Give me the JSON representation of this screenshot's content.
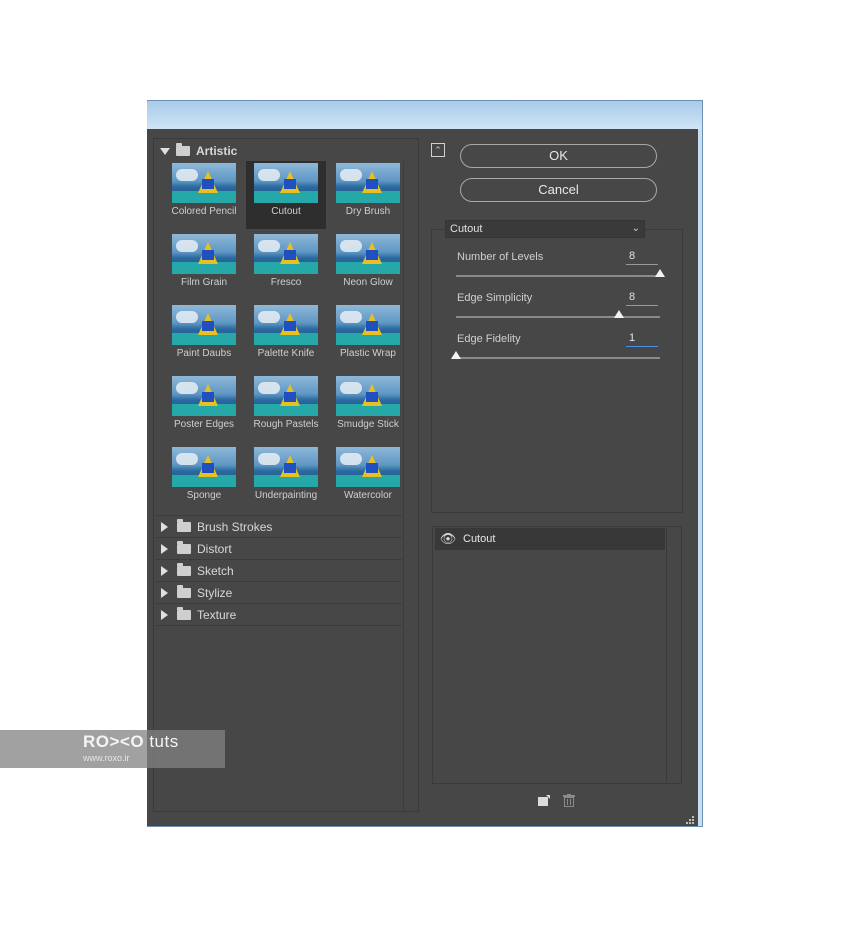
{
  "filter_gallery": {
    "categories": {
      "artistic": {
        "label": "Artistic",
        "filters": [
          {
            "label": "Colored Pencil"
          },
          {
            "label": "Cutout",
            "selected": true
          },
          {
            "label": "Dry Brush"
          },
          {
            "label": "Film Grain"
          },
          {
            "label": "Fresco"
          },
          {
            "label": "Neon Glow"
          },
          {
            "label": "Paint Daubs"
          },
          {
            "label": "Palette Knife"
          },
          {
            "label": "Plastic Wrap"
          },
          {
            "label": "Poster Edges"
          },
          {
            "label": "Rough Pastels"
          },
          {
            "label": "Smudge Stick"
          },
          {
            "label": "Sponge"
          },
          {
            "label": "Underpainting"
          },
          {
            "label": "Watercolor"
          }
        ]
      },
      "collapsed": [
        "Brush Strokes",
        "Distort",
        "Sketch",
        "Stylize",
        "Texture"
      ]
    }
  },
  "buttons": {
    "ok": "OK",
    "cancel": "Cancel"
  },
  "settings": {
    "filter_select": "Cutout",
    "params": [
      {
        "label": "Number of Levels",
        "value": "8",
        "fraction": 1.0
      },
      {
        "label": "Edge Simplicity",
        "value": "8",
        "fraction": 0.8
      },
      {
        "label": "Edge Fidelity",
        "value": "1",
        "fraction": 0.0
      }
    ]
  },
  "layers": {
    "items": [
      {
        "name": "Cutout",
        "visible": true
      }
    ]
  },
  "watermark": {
    "logo_bold": "RO><O",
    "logo_light": " tuts",
    "url": "www.roxo.ir"
  }
}
